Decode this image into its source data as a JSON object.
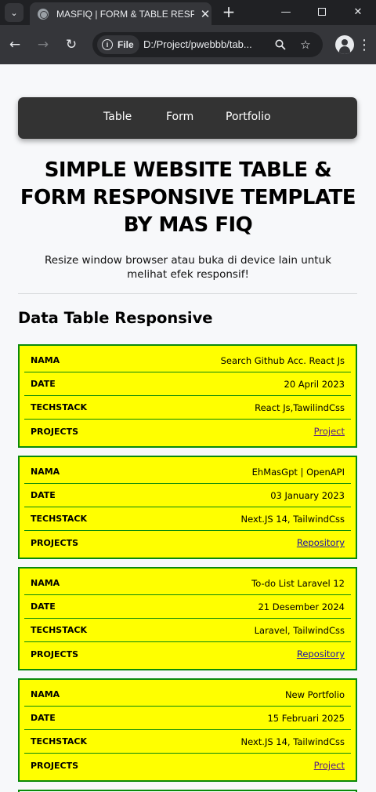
{
  "browser": {
    "tab_title": "MASFIQ | FORM & TABLE RESPONSIVE",
    "url_chip": "File",
    "url": "D:/Project/pwebbb/tab..."
  },
  "nav": {
    "items": [
      "Table",
      "Form",
      "Portfolio"
    ]
  },
  "hero": {
    "title_line1": "SIMPLE WEBSITE TABLE &",
    "title_line2": "FORM RESPONSIVE TEMPLATE",
    "title_line3": "BY MAS FIQ",
    "subtitle_line1": "Resize window browser atau buka di device lain untuk",
    "subtitle_line2": "melihat efek responsif!"
  },
  "section_title": "Data Table Responsive",
  "labels": {
    "nama": "NAMA",
    "date": "DATE",
    "techstack": "TECHSTACK",
    "projects": "PROJECTS"
  },
  "rows": [
    {
      "nama": "Search Github Acc. React Js",
      "date": "20 April 2023",
      "techstack": "React Js,TawilindCss",
      "projects": "Project"
    },
    {
      "nama": "EhMasGpt | OpenAPI",
      "date": "03 January 2023",
      "techstack": "Next.JS 14, TailwindCss",
      "projects": "Repository"
    },
    {
      "nama": "To-do List Laravel 12",
      "date": "21 Desember 2024",
      "techstack": "Laravel, TailwindCss",
      "projects": "Repository"
    },
    {
      "nama": "New Portfolio",
      "date": "15 Februari 2025",
      "techstack": "Next.JS 14, TailwindCss",
      "projects": "Project"
    }
  ],
  "colors": {
    "card_bg": "#ffff00",
    "card_border": "#0a8a0a",
    "navbar_bg": "#333333"
  }
}
